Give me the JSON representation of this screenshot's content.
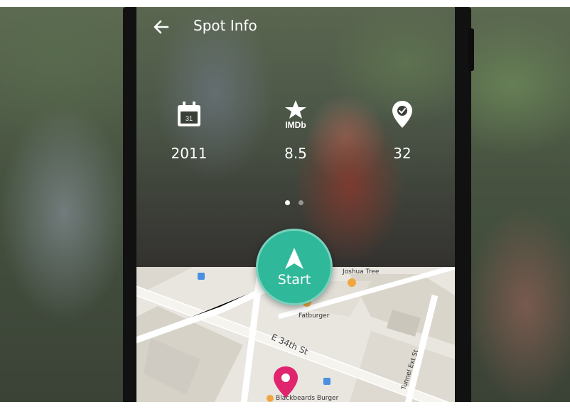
{
  "appbar": {
    "title": "Spot Info"
  },
  "stats": [
    {
      "icon": "calendar-icon",
      "icon_text": "31",
      "value": "2011"
    },
    {
      "icon": "imdb-star-icon",
      "icon_text": "IMDb",
      "value": "8.5"
    },
    {
      "icon": "location-check-icon",
      "value": "32"
    }
  ],
  "pager": {
    "pages": 2,
    "active": 0
  },
  "start_button": {
    "label": "Start"
  },
  "map": {
    "labels": {
      "street1": "E 34th St",
      "street2": "Tunnel Ext St",
      "poi1": "Joshua Tree",
      "poi2": "Fatburger",
      "poi3": "Blackbeards Burger"
    }
  },
  "colors": {
    "accent": "#2fb899",
    "pin": "#e0246e"
  }
}
